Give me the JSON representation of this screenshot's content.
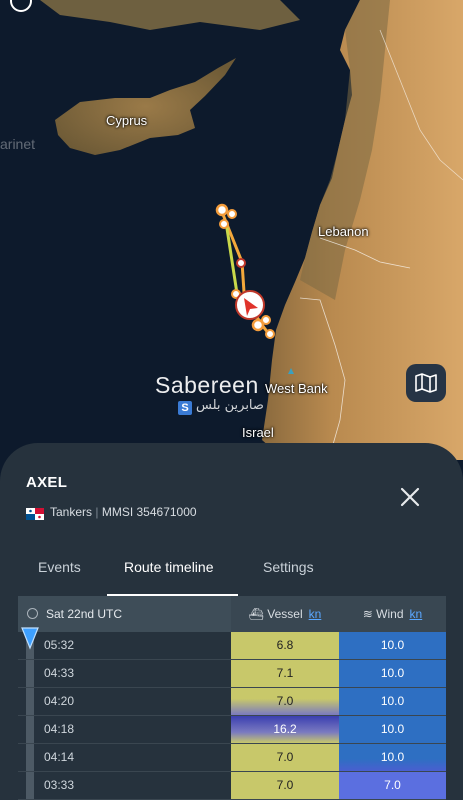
{
  "map": {
    "labels": {
      "cyprus": "Cyprus",
      "lebanon": "Lebanon",
      "west_bank": "West Bank",
      "israel": "Israel"
    },
    "watermark": {
      "text": "Sabereen",
      "arabic": "صابرين بلس",
      "site": "arinet"
    },
    "colors": {
      "sea": "#0d1a2c",
      "land": "#b5824a",
      "track": "#f39c3b"
    }
  },
  "vessel": {
    "name": "AXEL",
    "type": "Tankers",
    "mmsi_label": "MMSI 354671000",
    "flag": "panama-flag"
  },
  "tabs": [
    {
      "label": "Events"
    },
    {
      "label": "Route timeline"
    },
    {
      "label": "Settings"
    }
  ],
  "timeline": {
    "date_header": "Sat 22nd UTC",
    "vessel_header": "Vessel",
    "wind_header": "Wind",
    "unit": "kn",
    "rows": [
      {
        "time": "05:32",
        "vessel": "6.8",
        "wind": "10.0"
      },
      {
        "time": "04:33",
        "vessel": "7.1",
        "wind": "10.0"
      },
      {
        "time": "04:20",
        "vessel": "7.0",
        "wind": "10.0"
      },
      {
        "time": "04:18",
        "vessel": "16.2",
        "wind": "10.0"
      },
      {
        "time": "04:14",
        "vessel": "7.0",
        "wind": "10.0"
      },
      {
        "time": "03:33",
        "vessel": "7.0",
        "wind": "7.0"
      }
    ]
  }
}
